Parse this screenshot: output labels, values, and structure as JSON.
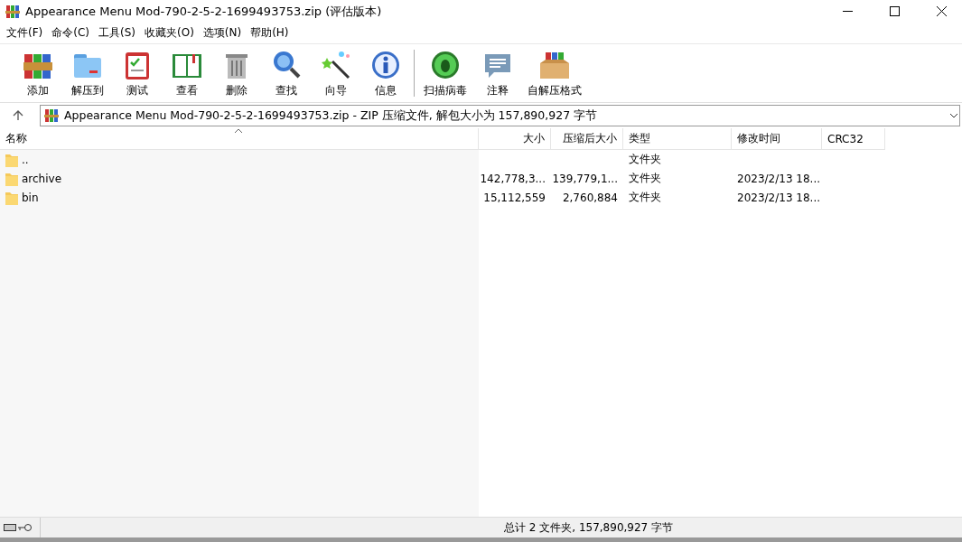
{
  "window": {
    "title": "Appearance Menu Mod-790-2-5-2-1699493753.zip (评估版本)"
  },
  "menu": [
    "文件(F)",
    "命令(C)",
    "工具(S)",
    "收藏夹(O)",
    "选项(N)",
    "帮助(H)"
  ],
  "toolbar": [
    {
      "label": "添加",
      "kind": "add"
    },
    {
      "label": "解压到",
      "kind": "extract"
    },
    {
      "label": "测试",
      "kind": "test"
    },
    {
      "label": "查看",
      "kind": "view"
    },
    {
      "label": "删除",
      "kind": "delete"
    },
    {
      "label": "查找",
      "kind": "find"
    },
    {
      "label": "向导",
      "kind": "wizard"
    },
    {
      "label": "信息",
      "kind": "info"
    },
    {
      "label": "扫描病毒",
      "kind": "scan",
      "separator_before": true
    },
    {
      "label": "注释",
      "kind": "comment"
    },
    {
      "label": "自解压格式",
      "kind": "sfx"
    }
  ],
  "address": {
    "value": "Appearance Menu Mod-790-2-5-2-1699493753.zip - ZIP 压缩文件, 解包大小为 157,890,927 字节"
  },
  "table": {
    "columns": [
      "名称",
      "大小",
      "压缩后大小",
      "类型",
      "修改时间",
      "CRC32"
    ],
    "rows": [
      {
        "name": "..",
        "size": "",
        "packed": "",
        "type": "文件夹",
        "modified": "",
        "crc": ""
      },
      {
        "name": "archive",
        "size": "142,778,3...",
        "packed": "139,779,1...",
        "type": "文件夹",
        "modified": "2023/2/13 18...",
        "crc": ""
      },
      {
        "name": "bin",
        "size": "15,112,559",
        "packed": "2,760,884",
        "type": "文件夹",
        "modified": "2023/2/13 18...",
        "crc": ""
      }
    ]
  },
  "status_bar": {
    "text": "总计 2 文件夹, 157,890,927 字节"
  }
}
